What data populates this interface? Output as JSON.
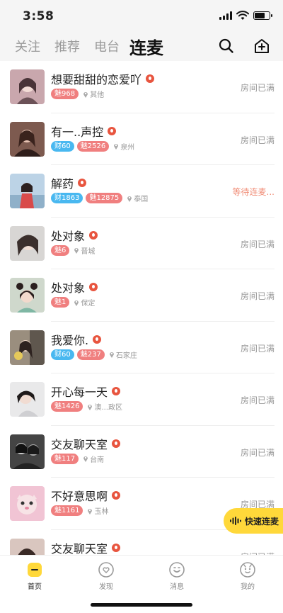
{
  "status_bar": {
    "time": "3:58"
  },
  "nav": {
    "tabs": [
      {
        "label": "关注",
        "active": false
      },
      {
        "label": "推荐",
        "active": false
      },
      {
        "label": "电台",
        "active": false
      },
      {
        "label": "连麦",
        "active": true
      }
    ],
    "icons": [
      "search-icon",
      "add-room-icon"
    ]
  },
  "rooms": [
    {
      "name": "想要甜甜的恋爱吖",
      "tags": [
        {
          "kind": "mei",
          "text": "魅968"
        }
      ],
      "location": "其他",
      "status": "房间已满",
      "waiting": false
    },
    {
      "name": "有一..声控",
      "tags": [
        {
          "kind": "cai",
          "text": "财60"
        },
        {
          "kind": "mei",
          "text": "魅2526"
        }
      ],
      "location": "泉州",
      "status": "房间已满",
      "waiting": false
    },
    {
      "name": "解药",
      "tags": [
        {
          "kind": "cai",
          "text": "财1863"
        },
        {
          "kind": "mei",
          "text": "魅12875"
        }
      ],
      "location": "泰国",
      "status": "等待连麦...",
      "waiting": true
    },
    {
      "name": "处对象",
      "tags": [
        {
          "kind": "mei",
          "text": "魅6"
        }
      ],
      "location": "晋城",
      "status": "房间已满",
      "waiting": false
    },
    {
      "name": "处对象",
      "tags": [
        {
          "kind": "mei",
          "text": "魅1"
        }
      ],
      "location": "保定",
      "status": "房间已满",
      "waiting": false
    },
    {
      "name": "我爱你.",
      "tags": [
        {
          "kind": "cai",
          "text": "财60"
        },
        {
          "kind": "mei",
          "text": "魅237"
        }
      ],
      "location": "石家庄",
      "status": "房间已满",
      "waiting": false
    },
    {
      "name": "开心每一天",
      "tags": [
        {
          "kind": "mei",
          "text": "魅1426"
        }
      ],
      "location": "澳...政区",
      "status": "房间已满",
      "waiting": false
    },
    {
      "name": "交友聊天室",
      "tags": [
        {
          "kind": "mei",
          "text": "魅117"
        }
      ],
      "location": "台南",
      "status": "房间已满",
      "waiting": false
    },
    {
      "name": "不好意思啊",
      "tags": [
        {
          "kind": "mei",
          "text": "魅1161"
        }
      ],
      "location": "玉林",
      "status": "房间已满",
      "waiting": false
    },
    {
      "name": "交友聊天室",
      "tags": [],
      "location": "",
      "status": "房间已满",
      "waiting": false
    }
  ],
  "quick_button": {
    "label": "快速连麦"
  },
  "bottom_tabs": [
    {
      "label": "首页",
      "icon": "home-icon",
      "active": true
    },
    {
      "label": "发现",
      "icon": "discover-icon",
      "active": false
    },
    {
      "label": "消息",
      "icon": "message-icon",
      "active": false
    },
    {
      "label": "我的",
      "icon": "profile-icon",
      "active": false
    }
  ],
  "colors": {
    "accent": "#ffd83a",
    "cai": "#49b8f0",
    "mei": "#f07f7f",
    "live": "#e8553f",
    "waiting": "#f08a73"
  }
}
